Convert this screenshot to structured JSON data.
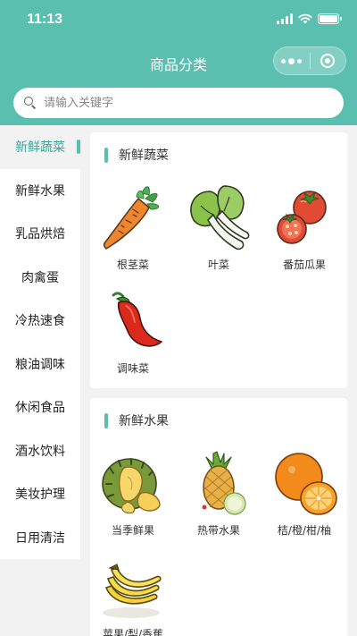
{
  "status_bar": {
    "time": "11:13"
  },
  "nav": {
    "title": "商品分类"
  },
  "search": {
    "placeholder": "请输入关键字",
    "value": ""
  },
  "sidebar": {
    "items": [
      {
        "label": "新鲜蔬菜",
        "active": true
      },
      {
        "label": "新鲜水果"
      },
      {
        "label": "乳品烘焙"
      },
      {
        "label": "肉禽蛋"
      },
      {
        "label": "冷热速食"
      },
      {
        "label": "粮油调味"
      },
      {
        "label": "休闲食品"
      },
      {
        "label": "酒水饮料"
      },
      {
        "label": "美妆护理"
      },
      {
        "label": "日用清洁"
      }
    ]
  },
  "sections": [
    {
      "title": "新鲜蔬菜",
      "items": [
        {
          "label": "根茎菜",
          "icon": "carrot-icon"
        },
        {
          "label": "叶菜",
          "icon": "bok-choy-icon"
        },
        {
          "label": "番茄瓜果",
          "icon": "tomato-icon"
        },
        {
          "label": "调味菜",
          "icon": "chili-pepper-icon"
        }
      ]
    },
    {
      "title": "新鲜水果",
      "items": [
        {
          "label": "当季鲜果",
          "icon": "durian-icon"
        },
        {
          "label": "热带水果",
          "icon": "pineapple-icon"
        },
        {
          "label": "桔/橙/柑/柚",
          "icon": "orange-icon"
        },
        {
          "label": "苹果/梨/香蕉",
          "icon": "banana-icon"
        }
      ]
    }
  ],
  "colors": {
    "accent": "#5bbfb0",
    "active_text": "#3aa898",
    "background": "#f2f2f2"
  }
}
